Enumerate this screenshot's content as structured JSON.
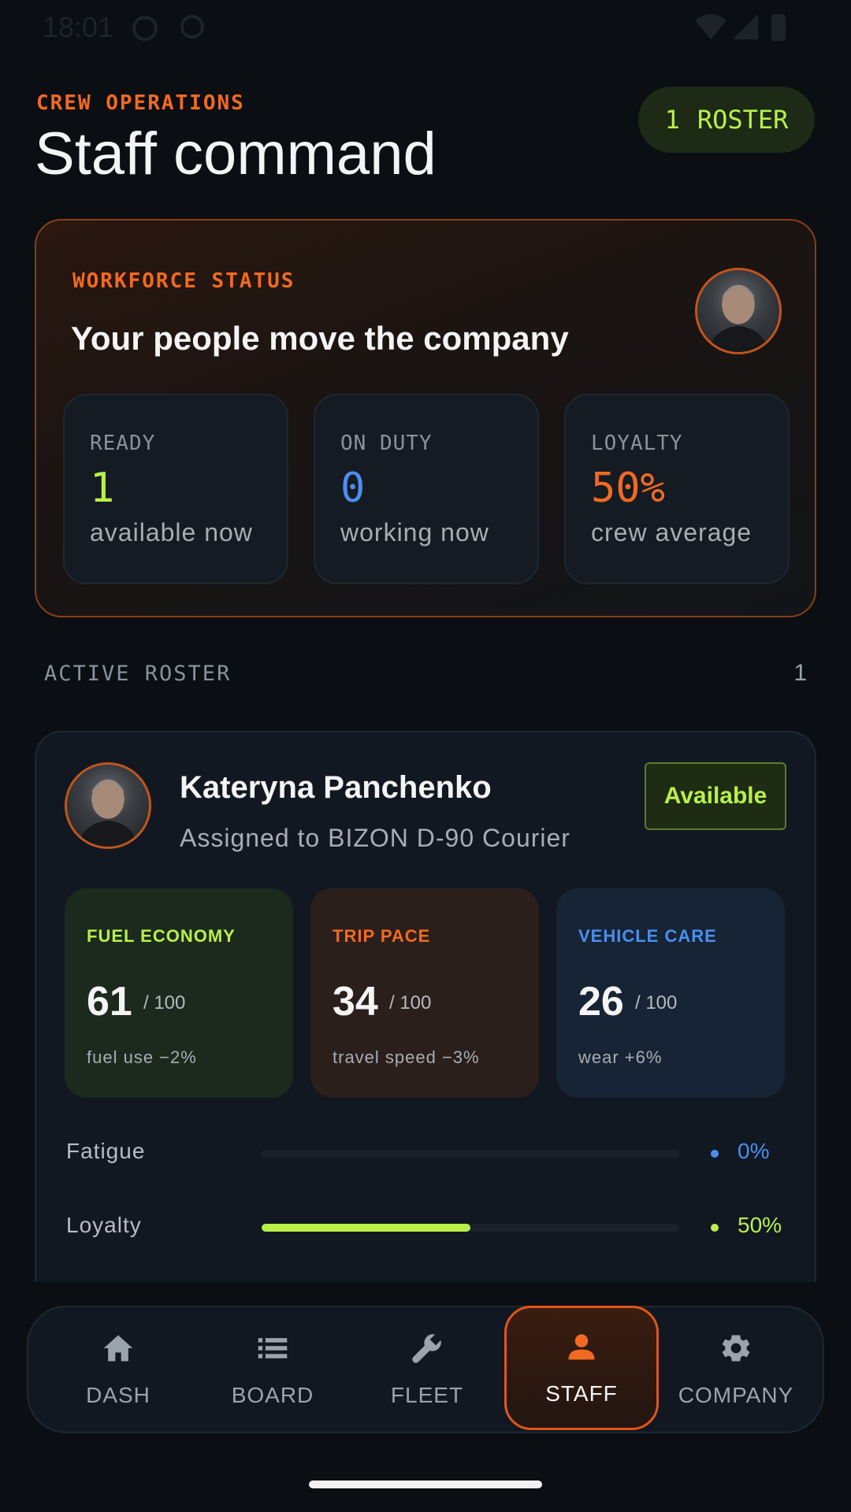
{
  "status_bar": {
    "time": "18:01"
  },
  "header": {
    "eyebrow": "CREW OPERATIONS",
    "title": "Staff command",
    "roster_count": "1",
    "roster_label": "ROSTER"
  },
  "workforce": {
    "eyebrow": "WORKFORCE STATUS",
    "headline": "Your people move the company",
    "stats": [
      {
        "label": "READY",
        "value": "1",
        "caption": "available now",
        "color": "#b9f04a"
      },
      {
        "label": "ON DUTY",
        "value": "0",
        "caption": "working now",
        "color": "#4a8ff0"
      },
      {
        "label": "LOYALTY",
        "value": "50%",
        "caption": "crew average",
        "color": "#f26a21"
      }
    ]
  },
  "roster": {
    "title": "ACTIVE ROSTER",
    "count": "1",
    "crew": {
      "name": "Kateryna Panchenko",
      "assignment": "Assigned to BIZON D-90 Courier",
      "status": "Available",
      "metrics": [
        {
          "label": "FUEL ECONOMY",
          "value": "61",
          "max": "/ 100",
          "note": "fuel use −2%",
          "color": "#b9f04a",
          "bg": "#1c2a1e"
        },
        {
          "label": "TRIP PACE",
          "value": "34",
          "max": "/ 100",
          "note": "travel speed −3%",
          "color": "#f26a21",
          "bg": "#2a1f1b"
        },
        {
          "label": "VEHICLE CARE",
          "value": "26",
          "max": "/ 100",
          "note": "wear +6%",
          "color": "#4a8ff0",
          "bg": "#172435"
        }
      ],
      "bars": [
        {
          "label": "Fatigue",
          "percent": 0,
          "display": "0%",
          "color": "#4a8ff0"
        },
        {
          "label": "Loyalty",
          "percent": 50,
          "display": "50%",
          "color": "#b9f04a"
        }
      ]
    }
  },
  "nav": {
    "items": [
      {
        "label": "DASH",
        "icon": "home-icon"
      },
      {
        "label": "BOARD",
        "icon": "list-icon"
      },
      {
        "label": "FLEET",
        "icon": "wrench-icon"
      },
      {
        "label": "STAFF",
        "icon": "person-icon",
        "active": true
      },
      {
        "label": "COMPANY",
        "icon": "gear-icon"
      }
    ]
  }
}
